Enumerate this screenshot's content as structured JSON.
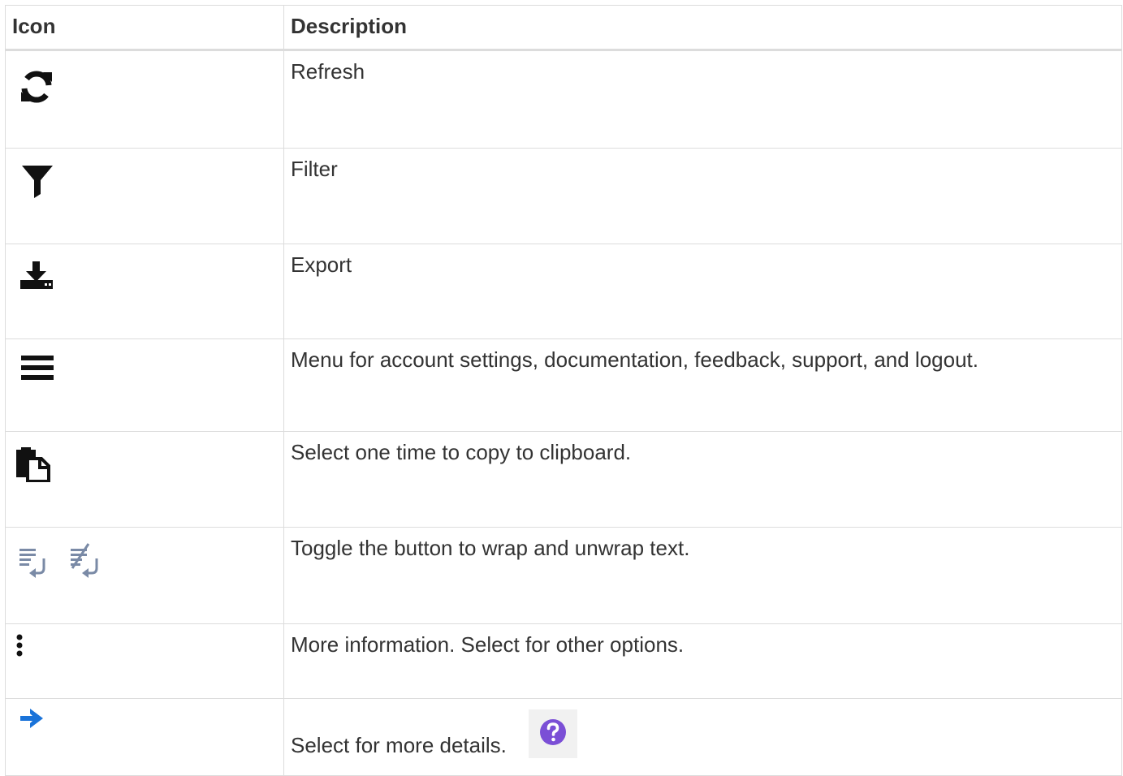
{
  "table": {
    "headers": {
      "icon": "Icon",
      "description": "Description"
    },
    "rows": [
      {
        "icon": "refresh-icon",
        "description": "Refresh"
      },
      {
        "icon": "filter-icon",
        "description": "Filter"
      },
      {
        "icon": "export-icon",
        "description": "Export"
      },
      {
        "icon": "hamburger-menu-icon",
        "description": "Menu for account settings, documentation, feedback, support, and logout."
      },
      {
        "icon": "copy-clipboard-icon",
        "description": "Select one time to copy to clipboard."
      },
      {
        "icon": "wrap-text-icon, unwrap-text-icon",
        "description": "Toggle the button to wrap and unwrap text."
      },
      {
        "icon": "vertical-ellipsis-icon",
        "description": "More information. Select for other options."
      },
      {
        "icon": "arrow-right-icon",
        "description": "Select for more details.",
        "extra_icon": "help-question-icon"
      }
    ]
  },
  "colors": {
    "text": "#333333",
    "border": "#dcdcdc",
    "icon_dark": "#111111",
    "icon_gray_blue": "#7a8aa6",
    "arrow_blue": "#1a73d9",
    "help_purple": "#7b4fd6"
  }
}
